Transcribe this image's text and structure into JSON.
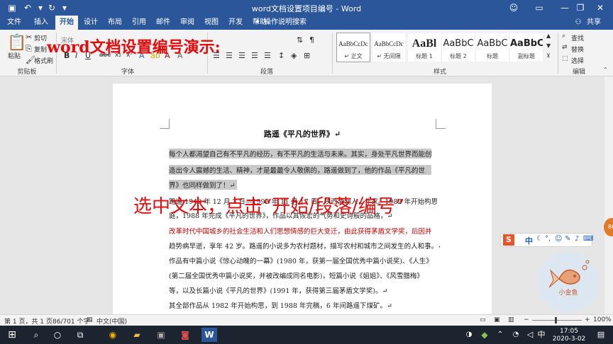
{
  "title_bar": {
    "title": "word文档设置项目编号 - Word",
    "save_icon": "save-icon",
    "undo_icon": "undo-icon",
    "redo_icon": "redo-icon",
    "customize_icon": "customize-quick-access-icon"
  },
  "tabs": [
    "文件",
    "插入",
    "开始",
    "设计",
    "布局",
    "引用",
    "邮件",
    "审阅",
    "视图",
    "开发",
    "帮助"
  ],
  "active_tab": "开始",
  "tell_me": "操作说明搜索",
  "share": "共享",
  "ribbon": {
    "clipboard": {
      "paste": "粘贴",
      "cut": "剪切",
      "copy": "复制",
      "format_painter": "格式刷",
      "group": "剪贴板"
    },
    "font": {
      "font_name": "宋体",
      "group": "字体",
      "bold": "B",
      "italic": "I",
      "underline": "U",
      "strike": "abc",
      "subscript": "x₂",
      "superscript": "x²"
    },
    "paragraph": {
      "group": "段落"
    },
    "styles": {
      "group": "样式",
      "items": [
        {
          "preview": "AaBbCcDc",
          "name": "↵ 正文"
        },
        {
          "preview": "AaBbCcDc",
          "name": "↵ 无间隔"
        },
        {
          "preview": "AaBl",
          "name": "标题 1"
        },
        {
          "preview": "AaBbC",
          "name": "标题 2"
        },
        {
          "preview": "AaBbC",
          "name": "标题"
        },
        {
          "preview": "AaBbC",
          "name": "副标题"
        }
      ]
    },
    "editing": {
      "find": "查找",
      "replace": "替换",
      "select": "选择",
      "group": "编辑"
    }
  },
  "overlay": {
    "top_caption": "word文档设置编号演示:",
    "mid_caption": "选中文本，点击“开始/段落/编号”"
  },
  "document": {
    "title": "路遥《平凡的世界》↵",
    "lines": [
      "每个人都渴望自己有不平凡的经历，有不平凡的生活与未来。其实，身处平凡世界而能创",
      "造出令人震撼的生活、精神，才是最最令人敬佩的，路遥做到了，他的作品《平凡的世",
      "界》也同样做到了！↵",
      "路遥 1949 年 12 月 3 日—1992 年 11 月 17 日，陕西清涧人，作家。1982 年开始构思，",
      "庭，1988 年完成《平凡的世界》，作品以其恢宏的气势和史诗般的品格，↵",
      "改革时代中国城乡的社会生活和人们思想情感的巨大变迁，由此获得茅盾文学奖，后因并",
      "趋势病早逝，享年 42 岁。路遥的小说多为农村题材，描写农村和城市之间发生的人和事。↵",
      "作品有中篇小说《惊心动魄的一幕》(1980 年，获第一届全国优秀中篇小说奖)、《人生》",
      "(第二届全国优秀中篇小说奖，并被改编成同名电影)，短篇小说《姐姐》、《风雪腊梅》",
      "等，以及长篇小说《平凡的世界》(1991 年，获得第三届茅盾文学奖)。↵",
      "其全部作品从 1982 年开始构思，到 1988 年完稿，6 年间路遥下煤矿。↵"
    ]
  },
  "ime": {
    "lang": "中",
    "icons": [
      "ime-logo-icon",
      "moon-icon",
      "punctuation-icon",
      "emoji-icon",
      "pen-icon",
      "voice-icon",
      "keyboard-icon",
      "skin-icon"
    ]
  },
  "logo": {
    "text": "小金鱼"
  },
  "status": {
    "page": "第 1 页，共 1 页",
    "words": "86/701 个字",
    "language": "中文(中国)",
    "zoom": "100%"
  },
  "taskbar": {
    "time": "17:05",
    "date": "2020-3-02",
    "ime": "中",
    "apps": [
      "windows-icon",
      "search-icon",
      "cortana-icon",
      "task-view-icon",
      "chrome-icon",
      "file-explorer-icon",
      "app-icon",
      "record-icon",
      "word-icon"
    ]
  }
}
